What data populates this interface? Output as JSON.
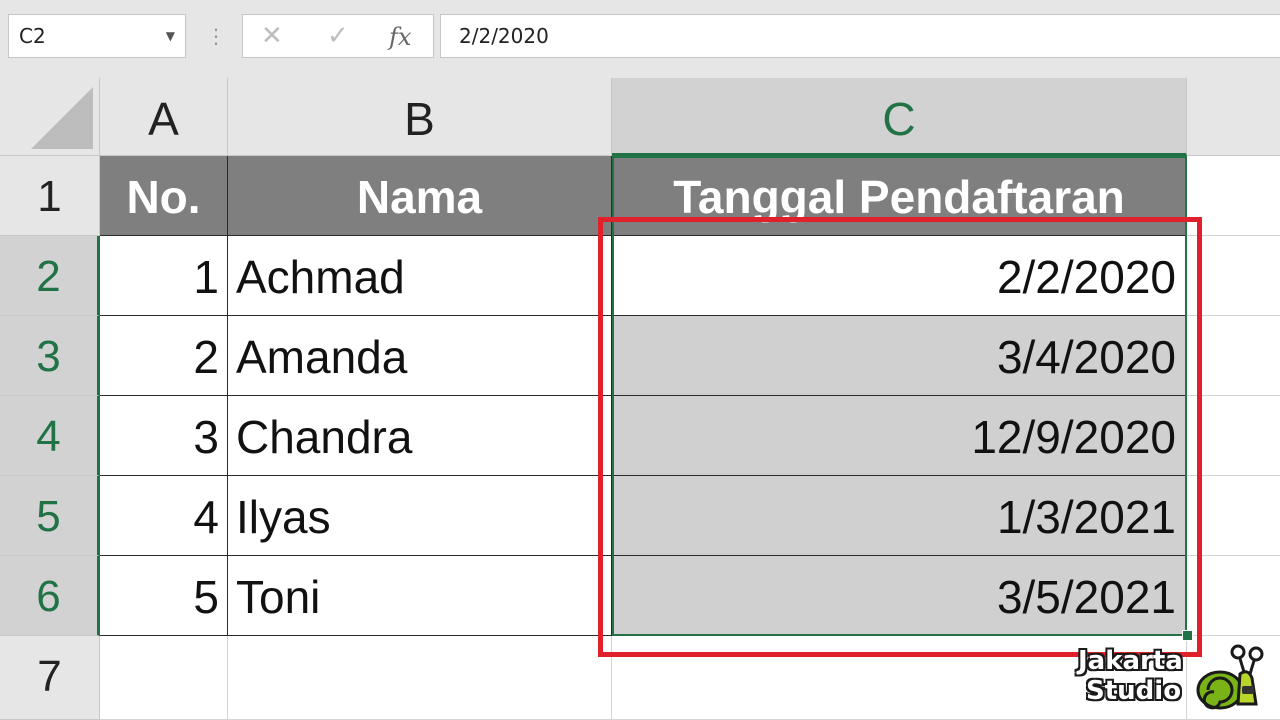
{
  "formula_bar": {
    "name_box": "C2",
    "formula_value": "2/2/2020",
    "cancel_symbol": "✕",
    "enter_symbol": "✓",
    "fx_symbol": "fx"
  },
  "columns": [
    "A",
    "B",
    "C"
  ],
  "rows": [
    "1",
    "2",
    "3",
    "4",
    "5",
    "6",
    "7"
  ],
  "table": {
    "headers": [
      "No.",
      "Nama",
      "Tanggal Pendaftaran"
    ],
    "records": [
      {
        "no": "1",
        "nama": "Achmad",
        "tanggal": "2/2/2020"
      },
      {
        "no": "2",
        "nama": "Amanda",
        "tanggal": "3/4/2020"
      },
      {
        "no": "3",
        "nama": "Chandra",
        "tanggal": "12/9/2020"
      },
      {
        "no": "4",
        "nama": "Ilyas",
        "tanggal": "1/3/2021"
      },
      {
        "no": "5",
        "nama": "Toni",
        "tanggal": "3/5/2021"
      }
    ]
  },
  "colors": {
    "selection": "#217346",
    "highlight_box": "#e0202b",
    "header_fill": "#7f7f7f",
    "selected_fill": "#d0d0d0"
  },
  "logo": {
    "line1": "Jakarta",
    "line2": "Studio"
  }
}
